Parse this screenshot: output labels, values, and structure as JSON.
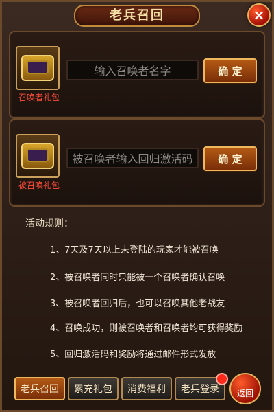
{
  "header": {
    "title": "老兵召回"
  },
  "panels": [
    {
      "gift_label": "召唤者礼包",
      "input_placeholder": "输入召唤者名字",
      "button_label": "确 定"
    },
    {
      "gift_label": "被召唤礼包",
      "input_placeholder": "被召唤者输入回归激活码",
      "button_label": "确 定"
    }
  ],
  "rules": {
    "title": "活动规则：",
    "items": [
      "1、7天及7天以上未登陆的玩家才能被召唤",
      "2、被召唤者同时只能被一个召唤者确认召唤",
      "3、被召唤者回归后，也可以召唤其他老战友",
      "4、召唤成功，则被召唤者和召唤者均可获得奖励",
      "5、回归激活码和奖励将通过邮件形式发放"
    ]
  },
  "bottom": {
    "tabs": [
      "老兵召回",
      "累充礼包",
      "消费福利",
      "老兵登录"
    ],
    "back_label": "返回"
  }
}
